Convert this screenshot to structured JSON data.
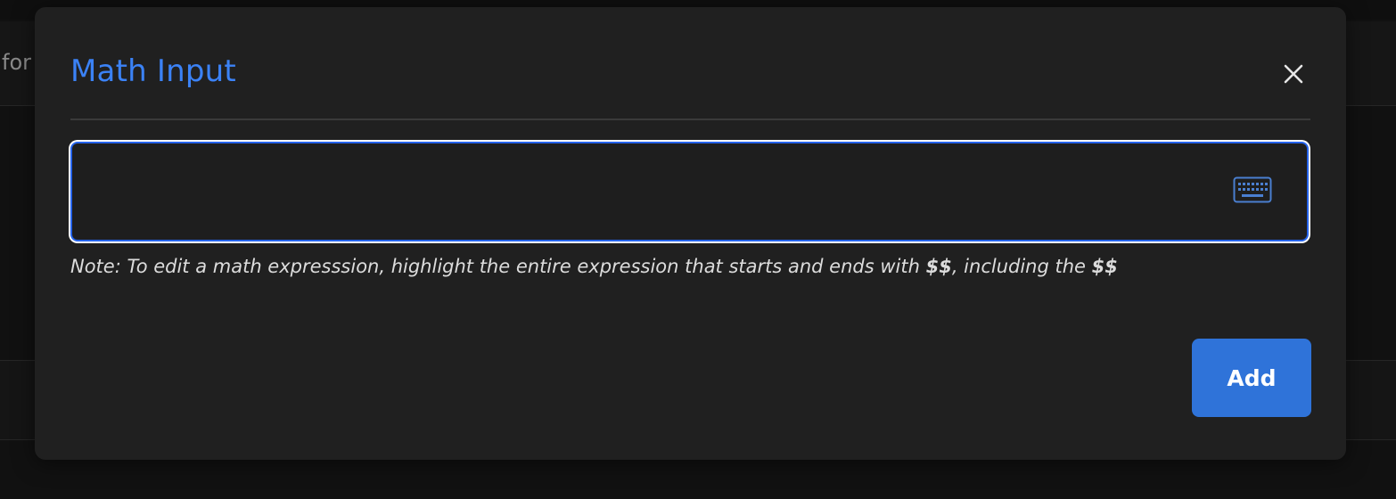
{
  "background": {
    "fragment_text": "for"
  },
  "modal": {
    "title": "Math Input",
    "close_icon": "close-icon",
    "math_field": {
      "value": "",
      "keyboard_icon": "keyboard-icon"
    },
    "note": {
      "prefix": "Note: To edit a math expresssion, highlight the entire expression that starts and ends with ",
      "token1": "$$",
      "middle": ", including the ",
      "token2": "$$"
    },
    "add_label": "Add"
  },
  "colors": {
    "accent": "#3b82f6",
    "button": "#2f73d9",
    "modal_bg": "#202020",
    "page_bg": "#111111"
  }
}
